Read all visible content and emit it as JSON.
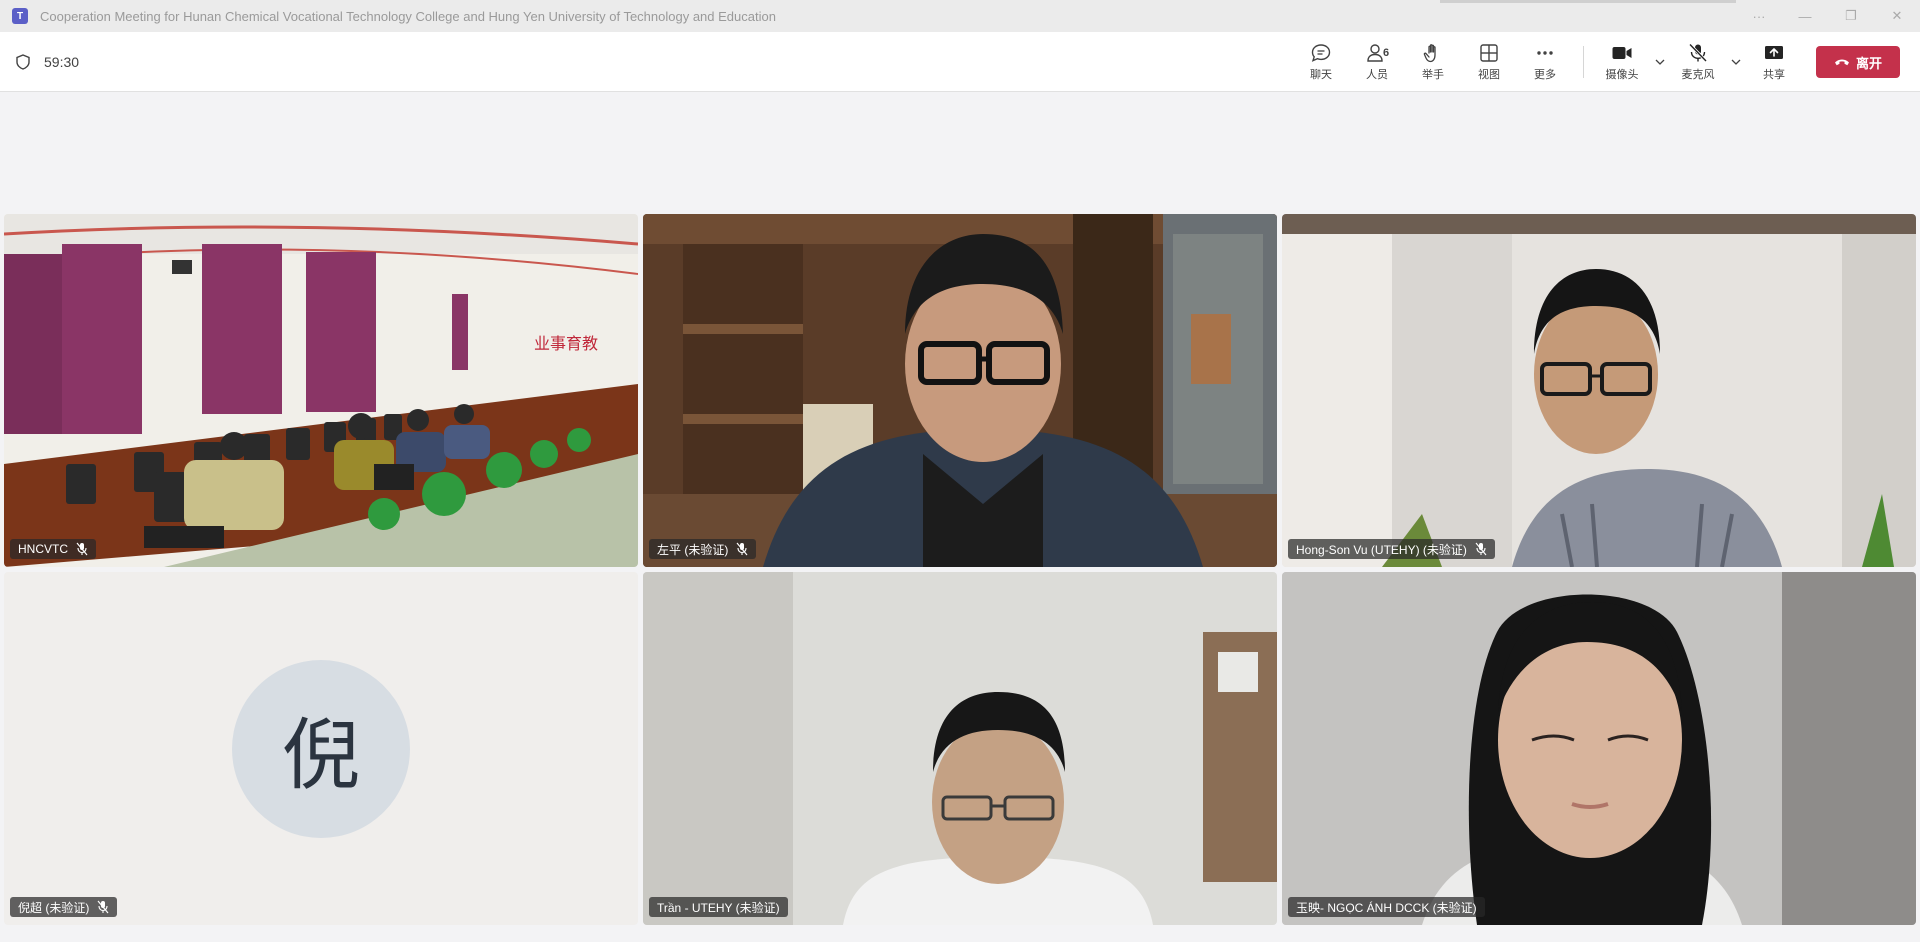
{
  "window": {
    "app_icon": "teams-icon",
    "title": "Cooperation Meeting for Hunan Chemical Vocational Technology College and Hung Yen University of Technology and Education",
    "controls": [
      "···",
      "—",
      "❐",
      "✕"
    ]
  },
  "toolbar": {
    "timer": "59:30",
    "chat_label": "聊天",
    "people_label": "人员",
    "people_count": "6",
    "raise_hand_label": "举手",
    "view_label": "视图",
    "more_label": "更多",
    "camera_label": "摄像头",
    "mic_label": "麦克风",
    "share_label": "共享",
    "leave_label": "离开"
  },
  "participants": [
    {
      "name": "HNCVTC",
      "muted": true,
      "video": "classroom"
    },
    {
      "name": "左平 (未验证)",
      "muted": true,
      "video": "man-bookshelf"
    },
    {
      "name": "Hong-Son Vu (UTEHY) (未验证)",
      "muted": true,
      "video": "man-office"
    },
    {
      "name": "倪超 (未验证)",
      "muted": true,
      "video": "off",
      "initial": "倪"
    },
    {
      "name": "Trần - UTEHY (未验证)",
      "muted": false,
      "video": "man-whitewall"
    },
    {
      "name": "玉映- NGỌC ÁNH DCCK (未验证)",
      "muted": false,
      "video": "woman"
    }
  ],
  "colors": {
    "leave": "#c4314b",
    "toolbar_bg": "#ffffff",
    "stage_bg": "#f3f3f5"
  }
}
